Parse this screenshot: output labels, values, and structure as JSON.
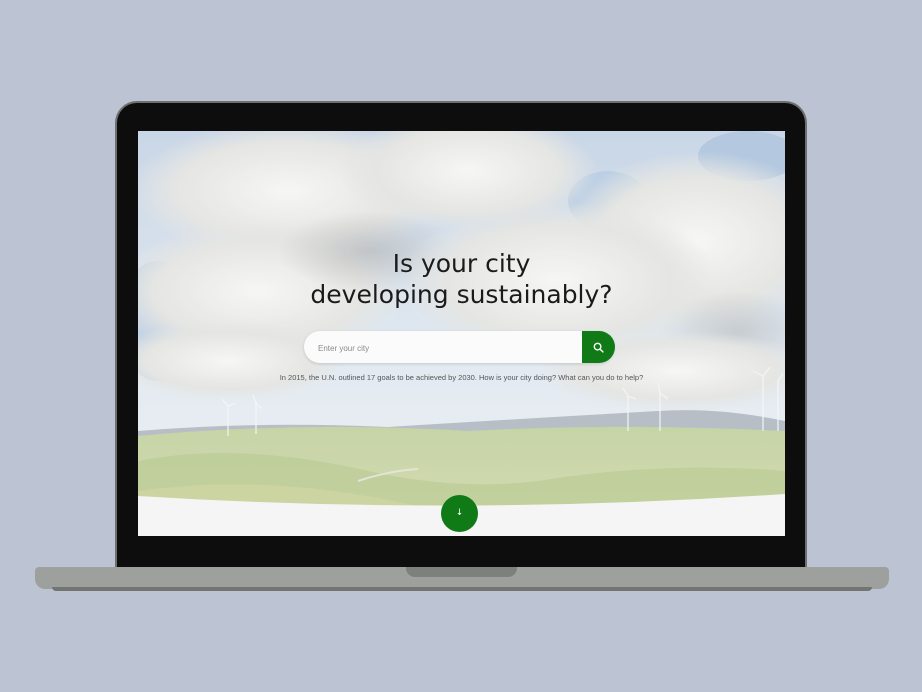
{
  "hero": {
    "headline_line1": "Is your city",
    "headline_line2": "developing sustainably?",
    "info_text": "In 2015, the U.N. outlined 17 goals to be achieved by 2030. How is your city doing? What can you do to help?"
  },
  "search": {
    "placeholder": "Enter your city",
    "value": "",
    "button_icon": "search-icon"
  },
  "scroll_button": {
    "icon": "arrow-down-icon",
    "label": "↓"
  },
  "colors": {
    "accent": "#0f7a16",
    "background": "#bcc4d4",
    "laptop_bezel": "#0d0d0d",
    "laptop_base": "#9da09d"
  }
}
